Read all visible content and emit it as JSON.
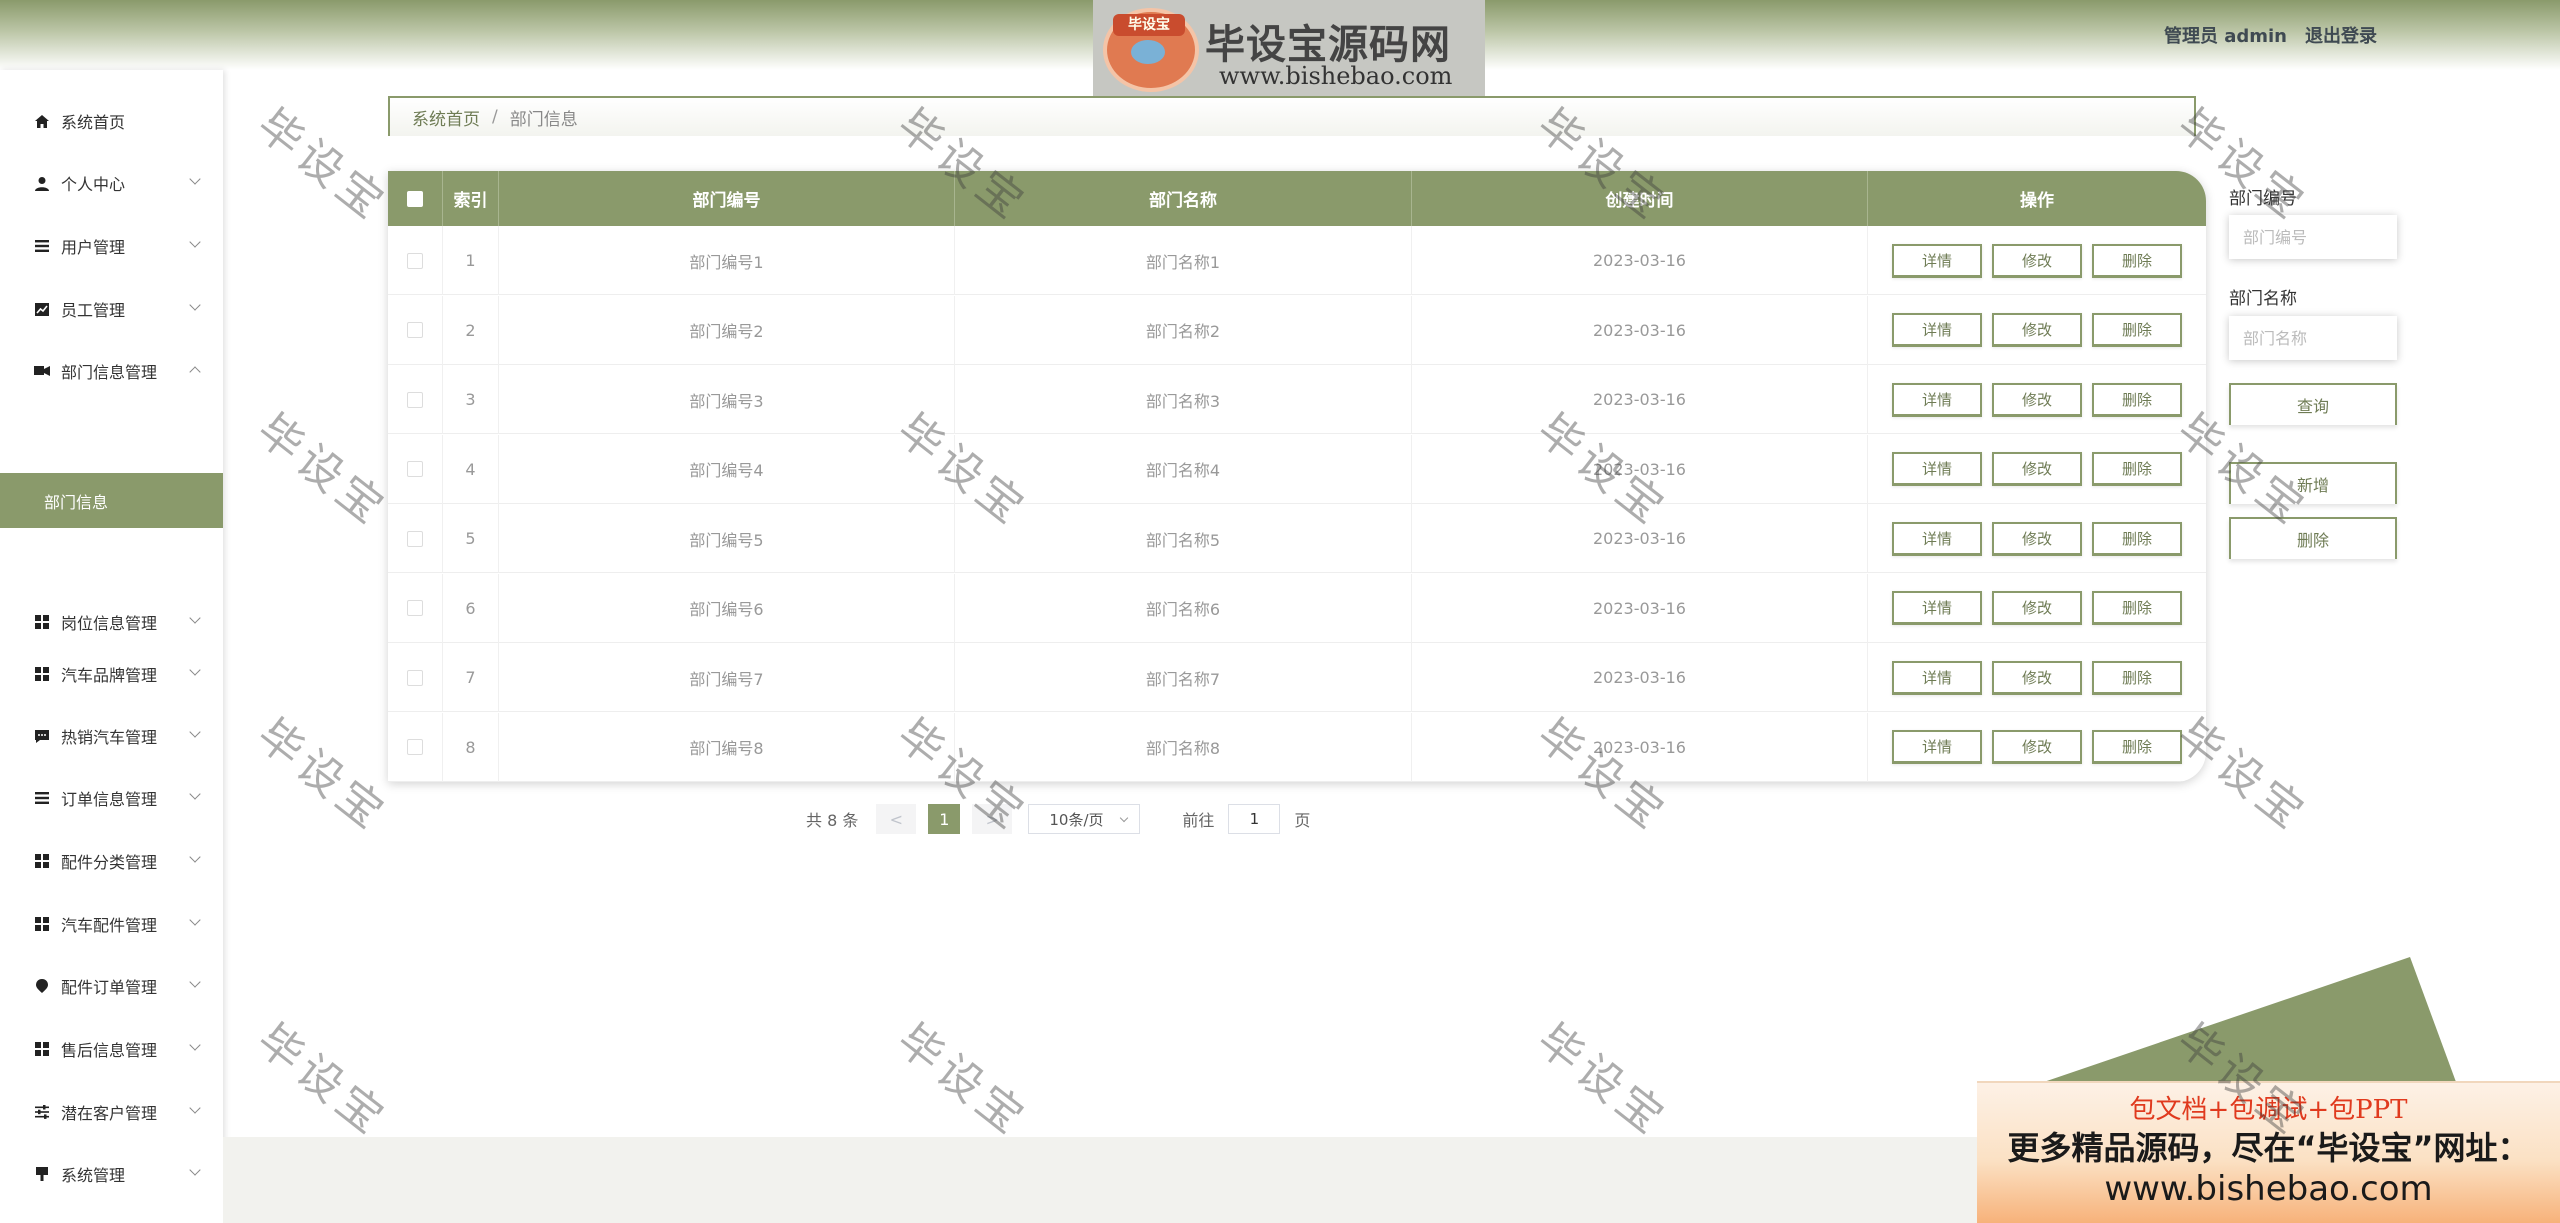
{
  "header": {
    "admin_label": "管理员 admin",
    "logout_label": "退出登录",
    "logo_badge": "毕设宝",
    "logo_title": "毕设宝源码网",
    "logo_url": "www.bishebao.com"
  },
  "sidebar": {
    "items": [
      {
        "label": "系统首页",
        "icon": "home-icon",
        "chevron": false
      },
      {
        "label": "个人中心",
        "icon": "user-icon",
        "chevron": true
      },
      {
        "label": "用户管理",
        "icon": "list-icon",
        "chevron": true
      },
      {
        "label": "员工管理",
        "icon": "chart-icon",
        "chevron": true
      },
      {
        "label": "部门信息管理",
        "icon": "car-icon",
        "chevron": true,
        "expanded": true
      },
      {
        "label": "岗位信息管理",
        "icon": "grid-icon",
        "chevron": true
      },
      {
        "label": "汽车品牌管理",
        "icon": "grid-icon",
        "chevron": true
      },
      {
        "label": "热销汽车管理",
        "icon": "chat-icon",
        "chevron": true
      },
      {
        "label": "订单信息管理",
        "icon": "list-icon",
        "chevron": true
      },
      {
        "label": "配件分类管理",
        "icon": "grid-icon",
        "chevron": true
      },
      {
        "label": "汽车配件管理",
        "icon": "grid-icon",
        "chevron": true
      },
      {
        "label": "配件订单管理",
        "icon": "pin-icon",
        "chevron": true
      },
      {
        "label": "售后信息管理",
        "icon": "grid-icon",
        "chevron": true
      },
      {
        "label": "潜在客户管理",
        "icon": "sliders-icon",
        "chevron": true
      },
      {
        "label": "系统管理",
        "icon": "board-icon",
        "chevron": true
      }
    ],
    "active_sub": "部门信息"
  },
  "breadcrumb": {
    "home": "系统首页",
    "sep": "/",
    "current": "部门信息"
  },
  "table": {
    "headers": [
      "索引",
      "部门编号",
      "部门名称",
      "创建时间",
      "操作"
    ],
    "rows": [
      {
        "index": "1",
        "code": "部门编号1",
        "name": "部门名称1",
        "date": "2023-03-16"
      },
      {
        "index": "2",
        "code": "部门编号2",
        "name": "部门名称2",
        "date": "2023-03-16"
      },
      {
        "index": "3",
        "code": "部门编号3",
        "name": "部门名称3",
        "date": "2023-03-16"
      },
      {
        "index": "4",
        "code": "部门编号4",
        "name": "部门名称4",
        "date": "2023-03-16"
      },
      {
        "index": "5",
        "code": "部门编号5",
        "name": "部门名称5",
        "date": "2023-03-16"
      },
      {
        "index": "6",
        "code": "部门编号6",
        "name": "部门名称6",
        "date": "2023-03-16"
      },
      {
        "index": "7",
        "code": "部门编号7",
        "name": "部门名称7",
        "date": "2023-03-16"
      },
      {
        "index": "8",
        "code": "部门编号8",
        "name": "部门名称8",
        "date": "2023-03-16"
      }
    ],
    "actions": [
      "详情",
      "修改",
      "删除"
    ]
  },
  "search": {
    "code_label": "部门编号",
    "code_placeholder": "部门编号",
    "name_label": "部门名称",
    "name_placeholder": "部门名称",
    "query_btn": "查询",
    "add_btn": "新增",
    "delete_btn": "删除"
  },
  "pagination": {
    "total": "共 8 条",
    "prev": "<",
    "page": "1",
    "next": ">",
    "page_size": "10条/页",
    "goto": "前往",
    "goto_value": "1",
    "page_unit": "页"
  },
  "promo": {
    "line1": "包文档+包调试+包PPT",
    "line2": "更多精品源码，尽在“毕设宝”网址：",
    "line3": "www.bishebao.com"
  },
  "watermark": "毕设宝",
  "colors": {
    "accent": "#8a9a6b",
    "accent_text": "#6f7c55"
  }
}
